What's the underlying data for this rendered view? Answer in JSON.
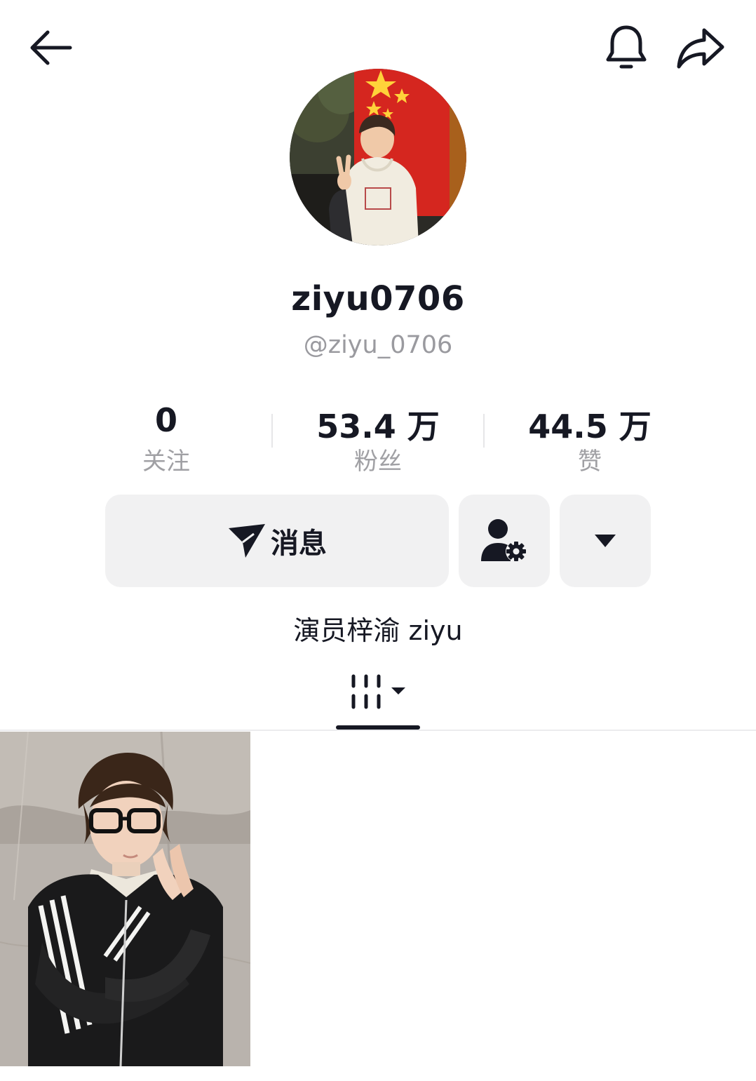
{
  "header": {
    "back_icon": "arrow-left-icon",
    "notify_icon": "bell-icon",
    "share_icon": "share-arrow-icon"
  },
  "profile": {
    "nickname": "ziyu0706",
    "handle": "@ziyu_0706",
    "bio": "演员梓渝 ziyu"
  },
  "stats": [
    {
      "value": "0",
      "label": "关注"
    },
    {
      "value": "53.4 万",
      "label": "粉丝"
    },
    {
      "value": "44.5 万",
      "label": "赞"
    }
  ],
  "actions": {
    "message_label": "消息",
    "message_icon": "paper-plane-icon",
    "follow_settings_icon": "user-gear-icon",
    "more_icon": "caret-down-icon"
  },
  "tabs": {
    "works_icon": "grid-columns-icon"
  },
  "colors": {
    "text_primary": "#161823",
    "text_secondary": "#9a9a9f",
    "button_bg": "#f1f1f2",
    "divider": "#ececee"
  }
}
